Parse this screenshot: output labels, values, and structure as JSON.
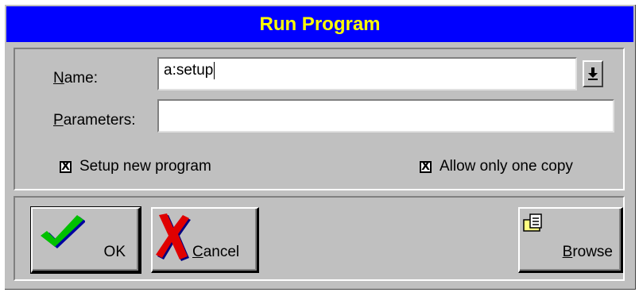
{
  "window": {
    "title": "Run Program"
  },
  "form": {
    "name_label_access": "N",
    "name_label_rest": "ame:",
    "name_value": "a:setup",
    "name_dropdown_icon": "arrow-down-with-bar",
    "params_label_access": "P",
    "params_label_rest": "arameters:",
    "params_value": ""
  },
  "options": {
    "setup_new_program": {
      "label": "Setup new program",
      "checked": true,
      "mark": "X"
    },
    "allow_one_copy": {
      "label": "Allow only one copy",
      "checked": true,
      "mark": "X"
    }
  },
  "buttons": {
    "ok": {
      "label": "OK",
      "icon": "green-checkmark"
    },
    "cancel": {
      "label_access": "C",
      "label_rest": "ancel",
      "icon": "red-x"
    },
    "browse": {
      "label_access": "B",
      "label_rest": "rowse",
      "icon": "folder-document"
    }
  },
  "colors": {
    "titlebar_bg": "#0000ff",
    "titlebar_text": "#ffff00",
    "dialog_bg": "#c0c0c0"
  }
}
